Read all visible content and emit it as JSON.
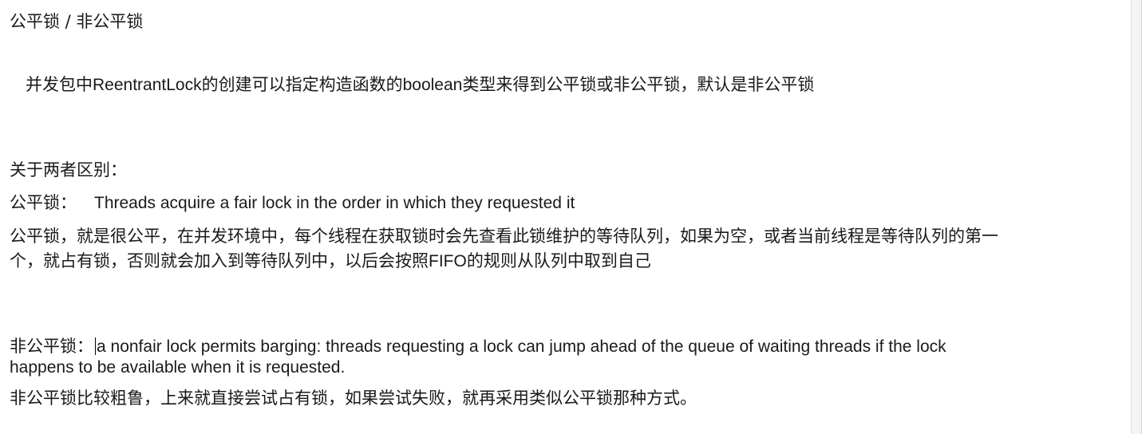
{
  "doc": {
    "heading": "公平锁 / 非公平锁",
    "intro": {
      "p1": "并发包中",
      "class_name": "ReentrantLock",
      "p2": "的创建可以指定构造函数的",
      "type_name": "boolean",
      "p3": "类型来得到公平锁或非公平锁，默认是非公平锁"
    },
    "diff_heading": "关于两者区别：",
    "fair": {
      "label": "公平锁：",
      "english": "Threads acquire a fair lock in the order in which they requested it",
      "desc_line1": "公平锁，就是很公平，在并发环境中，每个线程在获取锁时会先查看此锁维护的等待队列，如果为空，或者当前线程是等待队列的第一",
      "desc_line2_p1": "个，就占有锁，否则就会加入到等待队列中，以后会按照",
      "desc_line2_fifo": "FIFO",
      "desc_line2_p2": "的规则从队列中取到自己"
    },
    "nonfair": {
      "label": "非公平锁：",
      "english_line1": "a nonfair lock permits barging: threads requesting a lock can jump ahead of the queue of waiting threads if the lock",
      "english_line2": "happens to be available when it is requested.",
      "desc": "非公平锁比较粗鲁，上来就直接尝试占有锁，如果尝试失败，就再采用类似公平锁那种方式。"
    }
  }
}
